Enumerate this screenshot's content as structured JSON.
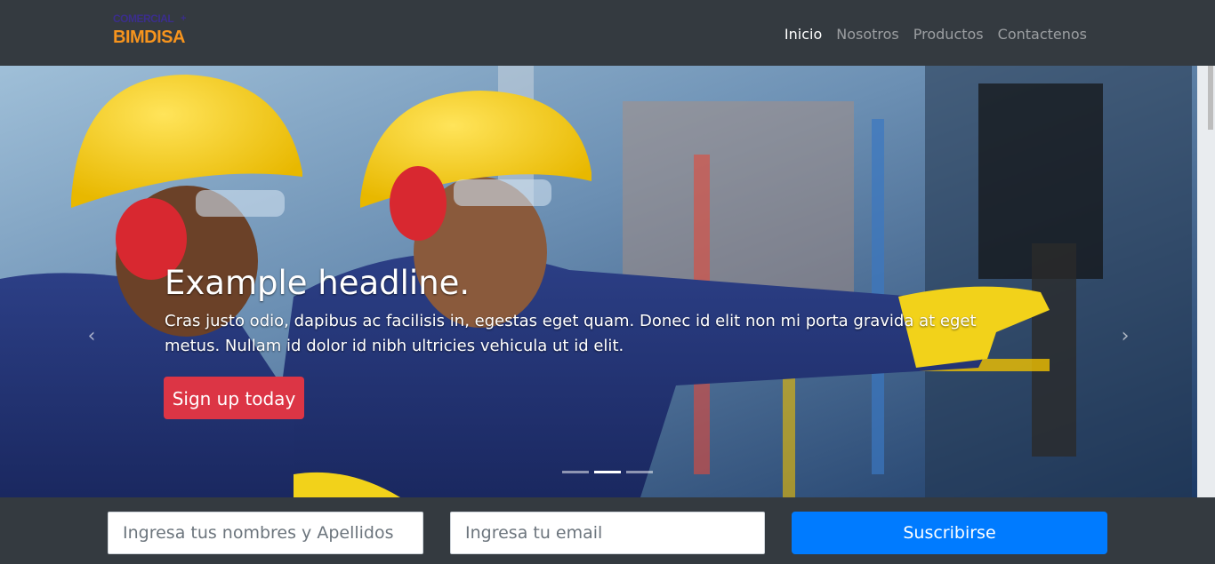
{
  "brand": {
    "top": "COMERCIAL",
    "plus": "+",
    "main": "BIMDISA"
  },
  "nav": {
    "items": [
      {
        "label": "Inicio",
        "active": true
      },
      {
        "label": "Nosotros",
        "active": false
      },
      {
        "label": "Productos",
        "active": false
      },
      {
        "label": "Contactenos",
        "active": false
      }
    ]
  },
  "carousel": {
    "headline": "Example headline.",
    "lead": "Cras justo odio, dapibus ac facilisis in, egestas eget quam. Donec id elit non mi porta gravida at eget metus. Nullam id dolor id nibh ultricies vehicula ut id elit.",
    "cta_label": "Sign up today",
    "prev_icon": "‹",
    "next_icon": "›",
    "indicator_count": 3,
    "active_indicator": 1
  },
  "subscribe": {
    "name_placeholder": "Ingresa tus nombres y Apellidos",
    "email_placeholder": "Ingresa tu email",
    "button_label": "Suscribirse"
  },
  "colors": {
    "navbar": "#343a40",
    "cta": "#dc3545",
    "primary": "#007bff",
    "brand_orange": "#f7941d",
    "brand_purple": "#3b2e8c"
  }
}
